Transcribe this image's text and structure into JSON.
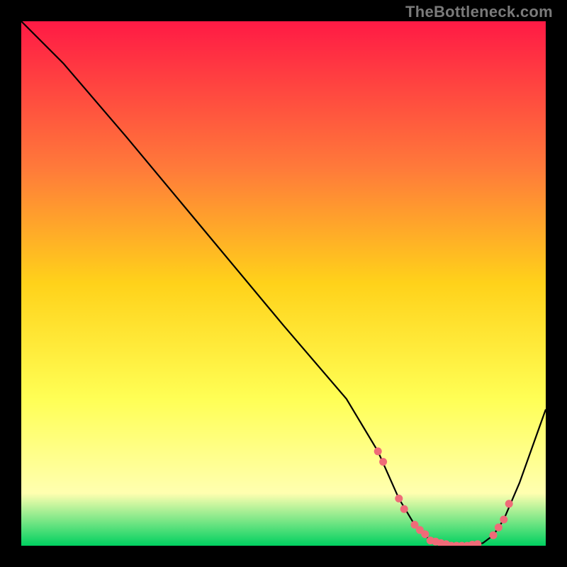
{
  "watermark": "TheBottleneck.com",
  "colors": {
    "bg": "#000000",
    "grad_top": "#ff1a45",
    "grad_mid1": "#ff7a3a",
    "grad_mid2": "#ffd21a",
    "grad_mid3": "#ffff55",
    "grad_mid4": "#ffffb0",
    "grad_bottom": "#00d060",
    "line": "#000000",
    "marker": "#ef6b78"
  },
  "chart_data": {
    "type": "line",
    "title": "",
    "xlabel": "",
    "ylabel": "",
    "xlim": [
      0,
      100
    ],
    "ylim": [
      0,
      100
    ],
    "x": [
      0,
      8,
      20,
      35,
      50,
      62,
      68,
      72,
      75,
      78,
      82,
      85,
      88,
      90,
      92,
      95,
      100
    ],
    "values": [
      100,
      92,
      78,
      60,
      42,
      28,
      18,
      9,
      4,
      1,
      0,
      0,
      0.5,
      2,
      5,
      12,
      26
    ],
    "markers_x": [
      68,
      69,
      72,
      73,
      75,
      76,
      77,
      78,
      79,
      80,
      81,
      82,
      83,
      84,
      85,
      86,
      87,
      90,
      91,
      92,
      93
    ],
    "markers_y": [
      18,
      16,
      9,
      7,
      4,
      3,
      2.2,
      1,
      0.8,
      0.5,
      0.3,
      0,
      0,
      0,
      0,
      0.2,
      0.3,
      2,
      3.5,
      5,
      8
    ]
  }
}
